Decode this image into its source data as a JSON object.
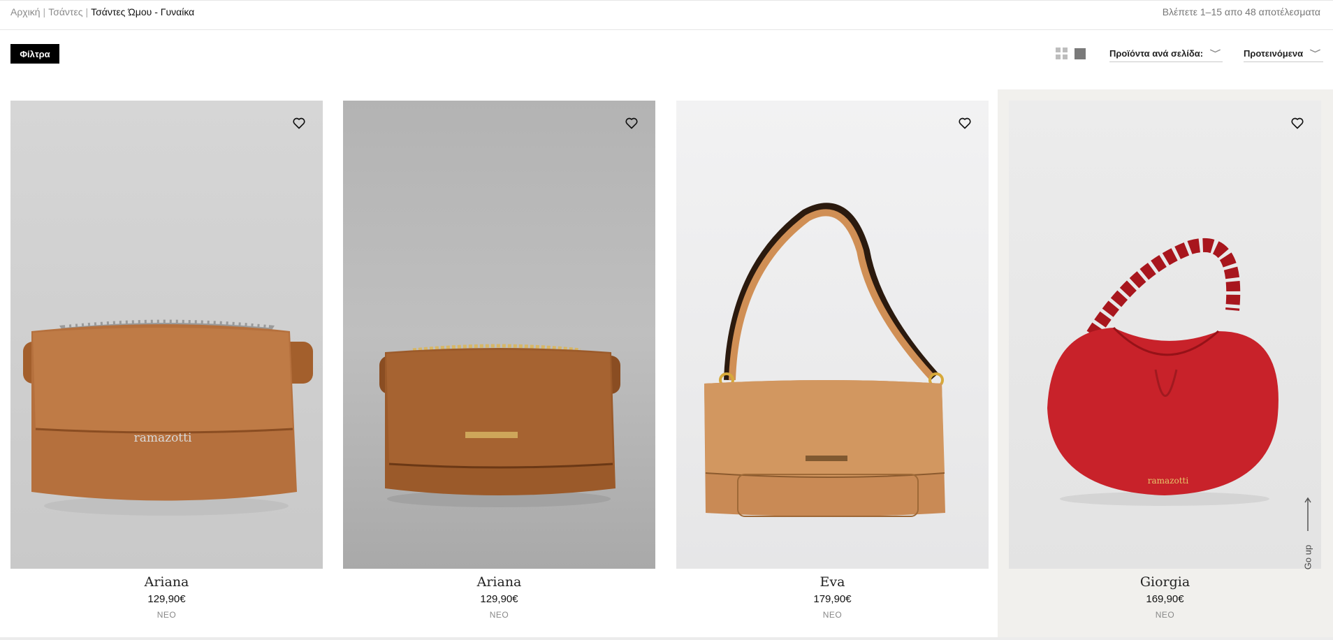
{
  "breadcrumb": {
    "home": "Αρχική",
    "category": "Τσάντες",
    "current": "Τσάντες Ώμου - Γυναίκα",
    "separator": "|"
  },
  "results_text": "Βλέπετε 1–15 απο 48 αποτέλεσματα",
  "toolbar": {
    "filters_label": "Φίλτρα",
    "per_page_label": "Προϊόντα ανά σελίδα:",
    "sort_label": "Προτεινόμενα",
    "chevron": "﹀"
  },
  "products": [
    {
      "name": "Ariana",
      "price": "129,90€",
      "badge": "ΝΕΟ",
      "color": "#b5703d",
      "hardware": "#c9c9c9"
    },
    {
      "name": "Ariana",
      "price": "129,90€",
      "badge": "ΝΕΟ",
      "color": "#9b5a2a",
      "hardware": "#d8b765"
    },
    {
      "name": "Eva",
      "price": "179,90€",
      "badge": "ΝΕΟ",
      "color": "#c98a55",
      "hardware": "#d7a93a"
    },
    {
      "name": "Giorgia",
      "price": "169,90€",
      "badge": "ΝΕΟ",
      "color": "#c8222a",
      "hardware": "#d9b84d"
    }
  ],
  "brand_mark": "ramazotti",
  "go_up_label": "Go up",
  "icons": {
    "heart": "heart-icon",
    "grid": "grid-view-icon",
    "list": "list-view-icon",
    "arrow_up": "arrow-up-icon"
  }
}
